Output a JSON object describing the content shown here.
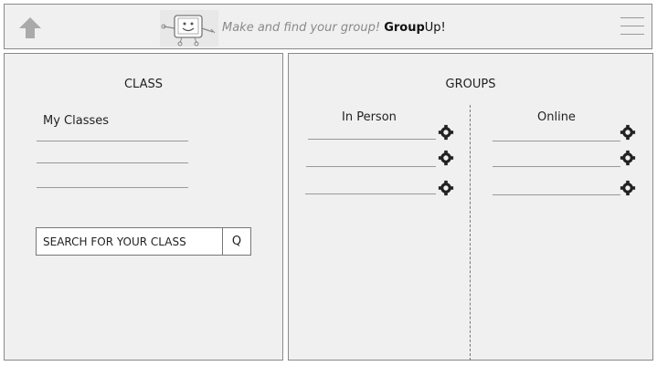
{
  "header": {
    "tagline_prefix": "Make and find your group! ",
    "brand_bold": "Group",
    "brand_rest": "Up!",
    "icons": {
      "back": "up-arrow-icon",
      "menu": "hamburger-menu-icon",
      "mascot": "mascot-logo"
    }
  },
  "class_panel": {
    "title": "CLASS",
    "my_classes_label": "My Classes",
    "search": {
      "placeholder": "SEARCH FOR YOUR CLASS",
      "button_label": "Q"
    }
  },
  "groups_panel": {
    "title": "GROUPS",
    "in_person": {
      "label": "In Person",
      "row_count": 3
    },
    "online": {
      "label": "Online",
      "row_count": 3
    },
    "row_icon": "gear-icon"
  },
  "colors": {
    "panel_bg": "#f0f0f0",
    "border": "#8a8a8a",
    "accent_icon": "#aaaaaa"
  }
}
